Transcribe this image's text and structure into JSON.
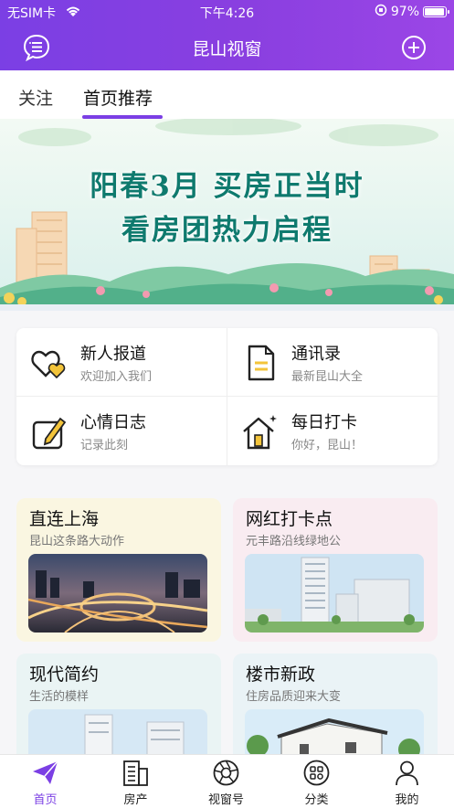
{
  "status": {
    "carrier": "无SIM卡",
    "time": "下午4:26",
    "battery": "97%"
  },
  "nav": {
    "title": "昆山视窗",
    "left_icon": "message-list-icon",
    "right_icon": "plus-circle-icon"
  },
  "tabs": [
    {
      "label": "关注"
    },
    {
      "label": "首页推荐"
    }
  ],
  "banner": {
    "line1": "阳春3月 买房正当时",
    "line2": "看房团热力启程"
  },
  "quick": [
    {
      "title": "新人报道",
      "subtitle": "欢迎加入我们",
      "icon": "hearts-icon"
    },
    {
      "title": "通讯录",
      "subtitle": "最新昆山大全",
      "icon": "document-icon"
    },
    {
      "title": "心情日志",
      "subtitle": "记录此刻",
      "icon": "pencil-note-icon"
    },
    {
      "title": "每日打卡",
      "subtitle": "你好，昆山！",
      "icon": "house-icon"
    }
  ],
  "cards": [
    {
      "title": "直连上海",
      "subtitle": "昆山这条路大动作"
    },
    {
      "title": "网红打卡点",
      "subtitle": "元丰路沿线绿地公"
    },
    {
      "title": "现代简约",
      "subtitle": "生活的模样"
    },
    {
      "title": "楼市新政",
      "subtitle": "住房品质迎来大变"
    }
  ],
  "tabbar": [
    {
      "label": "首页",
      "icon": "paper-plane-icon"
    },
    {
      "label": "房产",
      "icon": "building-icon"
    },
    {
      "label": "视窗号",
      "icon": "aperture-icon"
    },
    {
      "label": "分类",
      "icon": "grid-circle-icon"
    },
    {
      "label": "我的",
      "icon": "person-icon"
    }
  ],
  "colors": {
    "accent": "#7b3fe4",
    "banner_text": "#0f7a6e"
  }
}
